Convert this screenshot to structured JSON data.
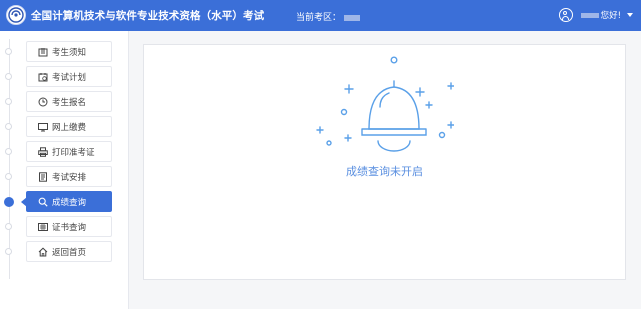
{
  "header": {
    "title": "全国计算机技术与软件专业技术资格（水平）考试",
    "region_label": "当前考区：",
    "greeting": "您好!"
  },
  "sidebar": {
    "items": [
      {
        "label": "考生须知",
        "icon": "notice-icon"
      },
      {
        "label": "考试计划",
        "icon": "calendar-icon"
      },
      {
        "label": "考生报名",
        "icon": "clock-icon"
      },
      {
        "label": "网上缴费",
        "icon": "monitor-icon"
      },
      {
        "label": "打印准考证",
        "icon": "printer-icon"
      },
      {
        "label": "考试安排",
        "icon": "document-icon"
      },
      {
        "label": "成绩查询",
        "icon": "search-icon",
        "active": true
      },
      {
        "label": "证书查询",
        "icon": "certificate-icon"
      },
      {
        "label": "返回首页",
        "icon": "home-icon"
      }
    ]
  },
  "main": {
    "message": "成绩查询未开启"
  },
  "colors": {
    "header": "#3b6fd8",
    "accent": "#3b6fd8",
    "message": "#5a8fe0",
    "bell": "#5aa0e8"
  }
}
